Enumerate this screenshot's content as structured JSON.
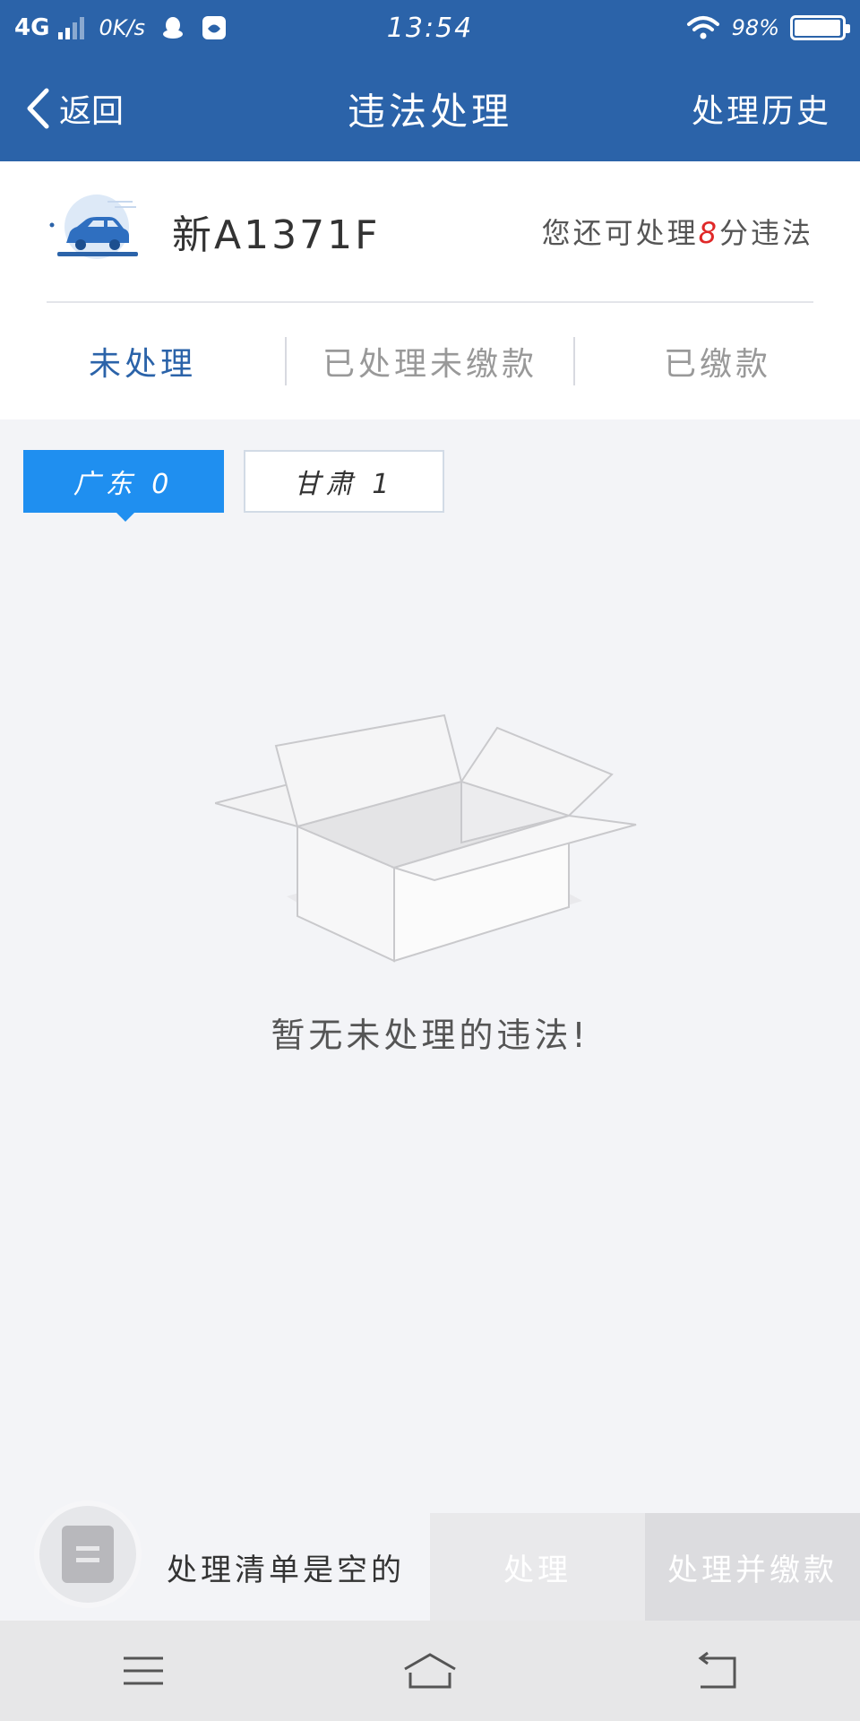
{
  "status": {
    "network": "4G",
    "speed": "0K/s",
    "time": "13:54",
    "battery": "98%",
    "battery_level": 0.98
  },
  "nav": {
    "back_label": "返回",
    "title": "违法处理",
    "history_label": "处理历史"
  },
  "vehicle": {
    "plate": "新A1371F",
    "points_prefix": "您还可处理",
    "points_value": "8",
    "points_suffix": "分违法"
  },
  "tabs": [
    {
      "label": "未处理",
      "active": true
    },
    {
      "label": "已处理未缴款",
      "active": false
    },
    {
      "label": "已缴款",
      "active": false
    }
  ],
  "provinces": [
    {
      "label": "广东 0",
      "active": true
    },
    {
      "label": "甘肃 1",
      "active": false
    }
  ],
  "empty": {
    "message": "暂无未处理的违法!"
  },
  "action_bar": {
    "cart_text": "处理清单是空的",
    "process_label": "处理",
    "process_pay_label": "处理并缴款"
  },
  "colors": {
    "header": "#2b63a9",
    "accent": "#1f8ff0",
    "highlight": "#e02828"
  }
}
